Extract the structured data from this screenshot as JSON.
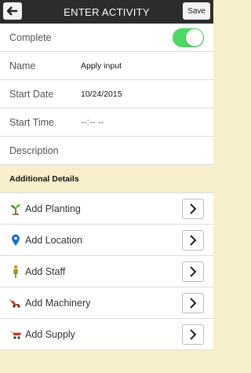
{
  "header": {
    "title": "ENTER ACTIVITY",
    "save_label": "Save",
    "back_icon": "back-arrow-icon"
  },
  "form": {
    "complete": {
      "label": "Complete",
      "on": true
    },
    "name": {
      "label": "Name",
      "value": "Apply input"
    },
    "start_date": {
      "label": "Start Date",
      "value": "10/24/2015"
    },
    "start_time": {
      "label": "Start Time",
      "value": "--:-- --"
    },
    "description": {
      "label": "Description"
    }
  },
  "additional": {
    "title": "Additional Details",
    "items": [
      {
        "label": "Add Planting",
        "icon": "sprout-icon"
      },
      {
        "label": "Add Location",
        "icon": "map-pin-icon"
      },
      {
        "label": "Add Staff",
        "icon": "person-icon"
      },
      {
        "label": "Add Machinery",
        "icon": "machinery-icon"
      },
      {
        "label": "Add Supply",
        "icon": "wheelbarrow-icon"
      }
    ]
  },
  "colors": {
    "toggle_on": "#4cd964",
    "header_bg": "#2c2c2c",
    "section_bg": "#f7efcc"
  }
}
